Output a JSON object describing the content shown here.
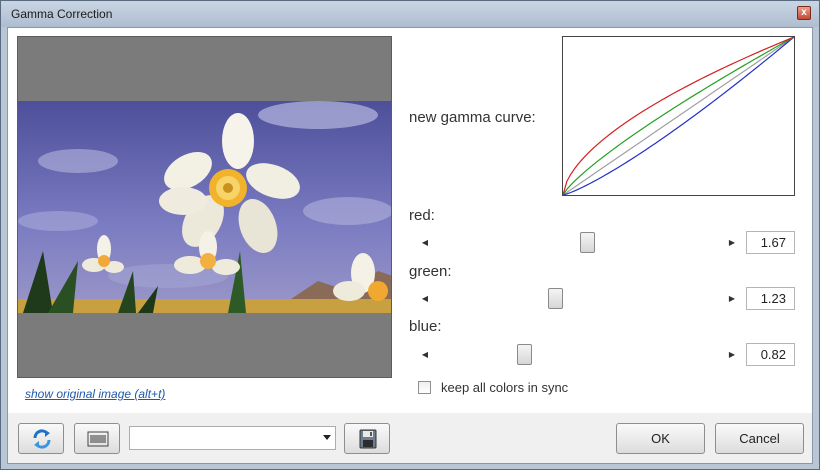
{
  "window": {
    "title": "Gamma Correction",
    "close_glyph": "x"
  },
  "preview": {
    "show_original_link": "show original image (alt+t)"
  },
  "curve": {
    "label": "new gamma curve:",
    "colors": {
      "red": "#d42020",
      "green": "#22a022",
      "blue": "#2030c8",
      "reference": "#a0a0a0"
    }
  },
  "channels": {
    "red": {
      "label": "red:",
      "value": "1.67",
      "level": 0.53
    },
    "green": {
      "label": "green:",
      "value": "1.23",
      "level": 0.42
    },
    "blue": {
      "label": "blue:",
      "value": "0.82",
      "level": 0.31
    }
  },
  "sync": {
    "label": "keep all colors in sync",
    "checked": false
  },
  "toolbar": {
    "reset_icon": "refresh-icon",
    "histogram_icon": "histogram-icon",
    "save_icon": "save-icon",
    "preset_value": ""
  },
  "buttons": {
    "ok": "OK",
    "cancel": "Cancel"
  }
}
